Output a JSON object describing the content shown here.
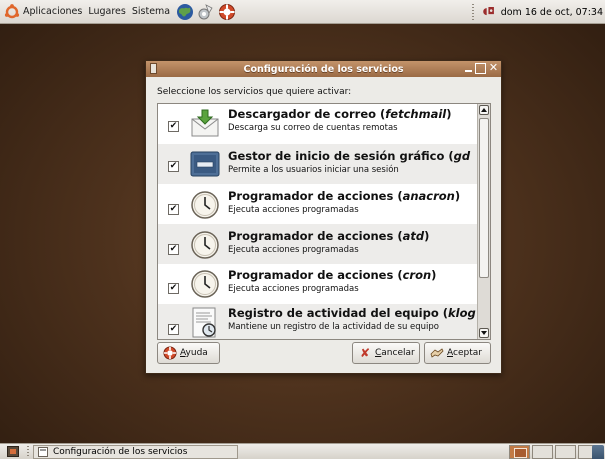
{
  "top_panel": {
    "menus": [
      "Aplicaciones",
      "Lugares",
      "Sistema"
    ],
    "clock": "dom 16 de oct, 07:34"
  },
  "window": {
    "title": "Configuración de los servicios",
    "instruction": "Seleccione los servicios que quiere activar:",
    "services": [
      {
        "name": "Descargador de correo (",
        "name_italic": "fetchmail",
        "name_tail": ")",
        "description": "Descarga su correo de cuentas remotas",
        "checked": true,
        "icon": "mail-download-icon"
      },
      {
        "name": "Gestor de inicio de sesión gráfico (",
        "name_italic": "gd",
        "name_tail": "",
        "description": "Permite a los usuarios iniciar una sesión",
        "checked": true,
        "icon": "display-manager-icon"
      },
      {
        "name": "Programador de acciones (",
        "name_italic": "anacron",
        "name_tail": ")",
        "description": "Ejecuta acciones programadas",
        "checked": true,
        "icon": "clock-icon"
      },
      {
        "name": "Programador de acciones (",
        "name_italic": "atd",
        "name_tail": ")",
        "description": "Ejecuta acciones programadas",
        "checked": true,
        "icon": "clock-icon"
      },
      {
        "name": "Programador de acciones (",
        "name_italic": "cron",
        "name_tail": ")",
        "description": "Ejecuta acciones programadas",
        "checked": true,
        "icon": "clock-icon"
      },
      {
        "name": "Registro de actividad del equipo (",
        "name_italic": "klog",
        "name_tail": "",
        "description": "Mantiene un registro de la actividad de su equipo",
        "checked": true,
        "icon": "log-viewer-icon"
      }
    ],
    "buttons": {
      "help": {
        "prefix": "",
        "mnemonic": "A",
        "rest": "yuda"
      },
      "cancel": {
        "prefix": "",
        "mnemonic": "C",
        "rest": "ancelar"
      },
      "accept": {
        "prefix": "",
        "mnemonic": "A",
        "rest": "ceptar"
      }
    }
  },
  "bottom_panel": {
    "task": "Configuración de los servicios"
  },
  "colors": {
    "titlebar": "#b07f58",
    "desktop": "#4e321d",
    "panel": "#e6e3de"
  }
}
